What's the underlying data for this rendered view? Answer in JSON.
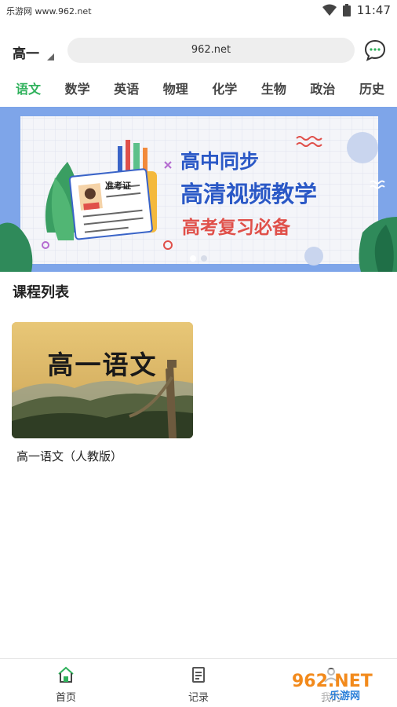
{
  "status_bar": {
    "carrier": "乐游网 www.962.net",
    "time": "11:47"
  },
  "header": {
    "grade": "高一",
    "search_text": "962.net"
  },
  "tabs": [
    {
      "label": "语文",
      "active": true
    },
    {
      "label": "数学",
      "active": false
    },
    {
      "label": "英语",
      "active": false
    },
    {
      "label": "物理",
      "active": false
    },
    {
      "label": "化学",
      "active": false
    },
    {
      "label": "生物",
      "active": false
    },
    {
      "label": "政治",
      "active": false
    },
    {
      "label": "历史",
      "active": false
    }
  ],
  "banner": {
    "line1": "高中同步",
    "line2": "高清视频教学",
    "line3": "高考复习必备",
    "card_label": "准考证",
    "slide_count": 2,
    "active_slide": 1
  },
  "course_section": {
    "title": "课程列表"
  },
  "courses": [
    {
      "thumb_title": "高一语文",
      "name": "高一语文（人教版）"
    }
  ],
  "bottom_nav": [
    {
      "label": "首页",
      "icon": "home-icon",
      "active": true
    },
    {
      "label": "记录",
      "icon": "record-icon",
      "active": false
    },
    {
      "label": "我的",
      "icon": "profile-icon",
      "active": false
    }
  ],
  "watermark": {
    "brand": "962.NET",
    "subtitle": "乐游网"
  },
  "colors": {
    "accent": "#2fb15b",
    "banner_blue": "#2a58c6",
    "banner_red": "#e0504a"
  }
}
